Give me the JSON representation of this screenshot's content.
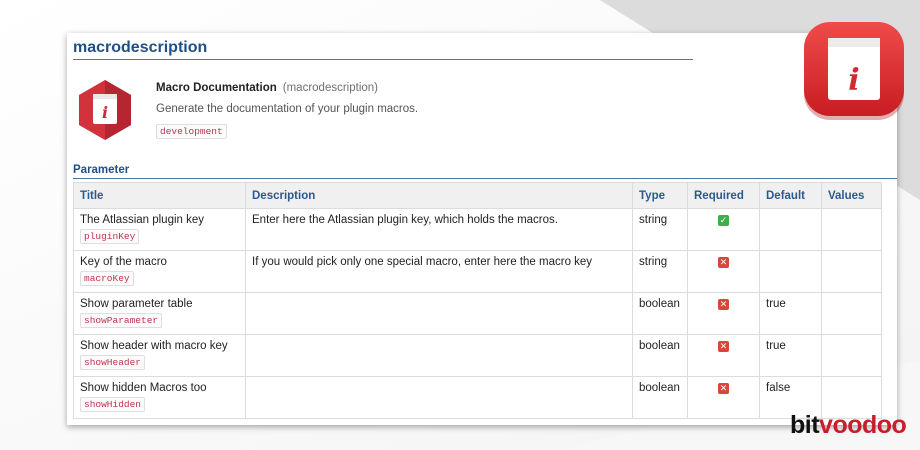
{
  "page": {
    "title": "macrodescription"
  },
  "macro": {
    "name": "Macro Documentation",
    "key": "(macrodescription)",
    "description": "Generate the documentation of your plugin macros.",
    "label": "development"
  },
  "parameters": {
    "section_title": "Parameter",
    "columns": {
      "title": "Title",
      "description": "Description",
      "type": "Type",
      "required": "Required",
      "default": "Default",
      "values": "Values"
    },
    "rows": [
      {
        "title": "The Atlassian plugin key",
        "key": "pluginKey",
        "description": "Enter here the Atlassian plugin key, which holds the macros.",
        "type": "string",
        "required": true,
        "default": "",
        "values": ""
      },
      {
        "title": "Key of the macro",
        "key": "macroKey",
        "description": "If you would pick only one special macro, enter here the macro key",
        "type": "string",
        "required": false,
        "default": "",
        "values": ""
      },
      {
        "title": "Show parameter table",
        "key": "showParameter",
        "description": "",
        "type": "boolean",
        "required": false,
        "default": "true",
        "values": ""
      },
      {
        "title": "Show header with macro key",
        "key": "showHeader",
        "description": "",
        "type": "boolean",
        "required": false,
        "default": "true",
        "values": ""
      },
      {
        "title": "Show hidden Macros too",
        "key": "showHidden",
        "description": "",
        "type": "boolean",
        "required": false,
        "default": "false",
        "values": ""
      }
    ]
  },
  "icons": {
    "required_yes": "check-icon",
    "required_no": "cross-icon",
    "macro": "info-book-icon"
  },
  "brand": {
    "part1": "bit",
    "part2": "voodoo"
  },
  "colors": {
    "accent": "#1f4f86",
    "brand_red": "#c71d2c",
    "check_green": "#3fae49",
    "cross_red": "#d9463a",
    "tag_text": "#c0334f"
  }
}
